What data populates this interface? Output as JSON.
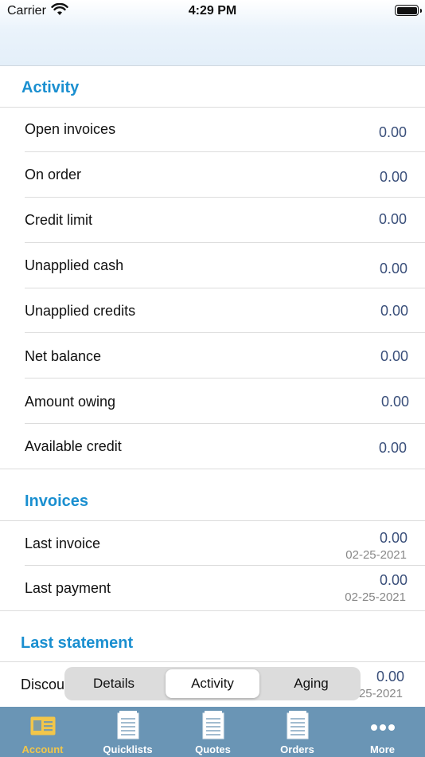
{
  "status_bar": {
    "carrier": "Carrier",
    "time": "4:29 PM"
  },
  "activity": {
    "title": "Activity",
    "rows": [
      {
        "label": "Open invoices",
        "value": "0.00"
      },
      {
        "label": "On order",
        "value": "0.00"
      },
      {
        "label": "Credit limit",
        "value": "0.00"
      },
      {
        "label": "Unapplied cash",
        "value": "0.00"
      },
      {
        "label": "Unapplied credits",
        "value": "0.00"
      },
      {
        "label": "Net balance",
        "value": "0.00"
      },
      {
        "label": "Amount owing",
        "value": "0.00"
      },
      {
        "label": "Available credit",
        "value": "0.00"
      }
    ]
  },
  "invoices": {
    "title": "Invoices",
    "rows": [
      {
        "label": "Last invoice",
        "value": "0.00",
        "date": "02-25-2021"
      },
      {
        "label": "Last payment",
        "value": "0.00",
        "date": "02-25-2021"
      }
    ]
  },
  "last_statement": {
    "title": "Last statement",
    "rows": [
      {
        "label": "Discou",
        "value": "0.00",
        "date": "25-2021"
      }
    ]
  },
  "segmented": {
    "options": [
      "Details",
      "Activity",
      "Aging"
    ],
    "selected": "Activity"
  },
  "tab_bar": {
    "items": [
      {
        "label": "Account",
        "icon": "account-card-icon",
        "active": true
      },
      {
        "label": "Quicklists",
        "icon": "document-icon",
        "active": false
      },
      {
        "label": "Quotes",
        "icon": "document-icon",
        "active": false
      },
      {
        "label": "Orders",
        "icon": "document-icon",
        "active": false
      },
      {
        "label": "More",
        "icon": "more-dots-icon",
        "active": false
      }
    ]
  },
  "colors": {
    "accent": "#1a8fd0",
    "value_text": "#3a4f7a",
    "tab_bar_bg": "#6a95b5",
    "tab_active": "#f2c64a"
  }
}
